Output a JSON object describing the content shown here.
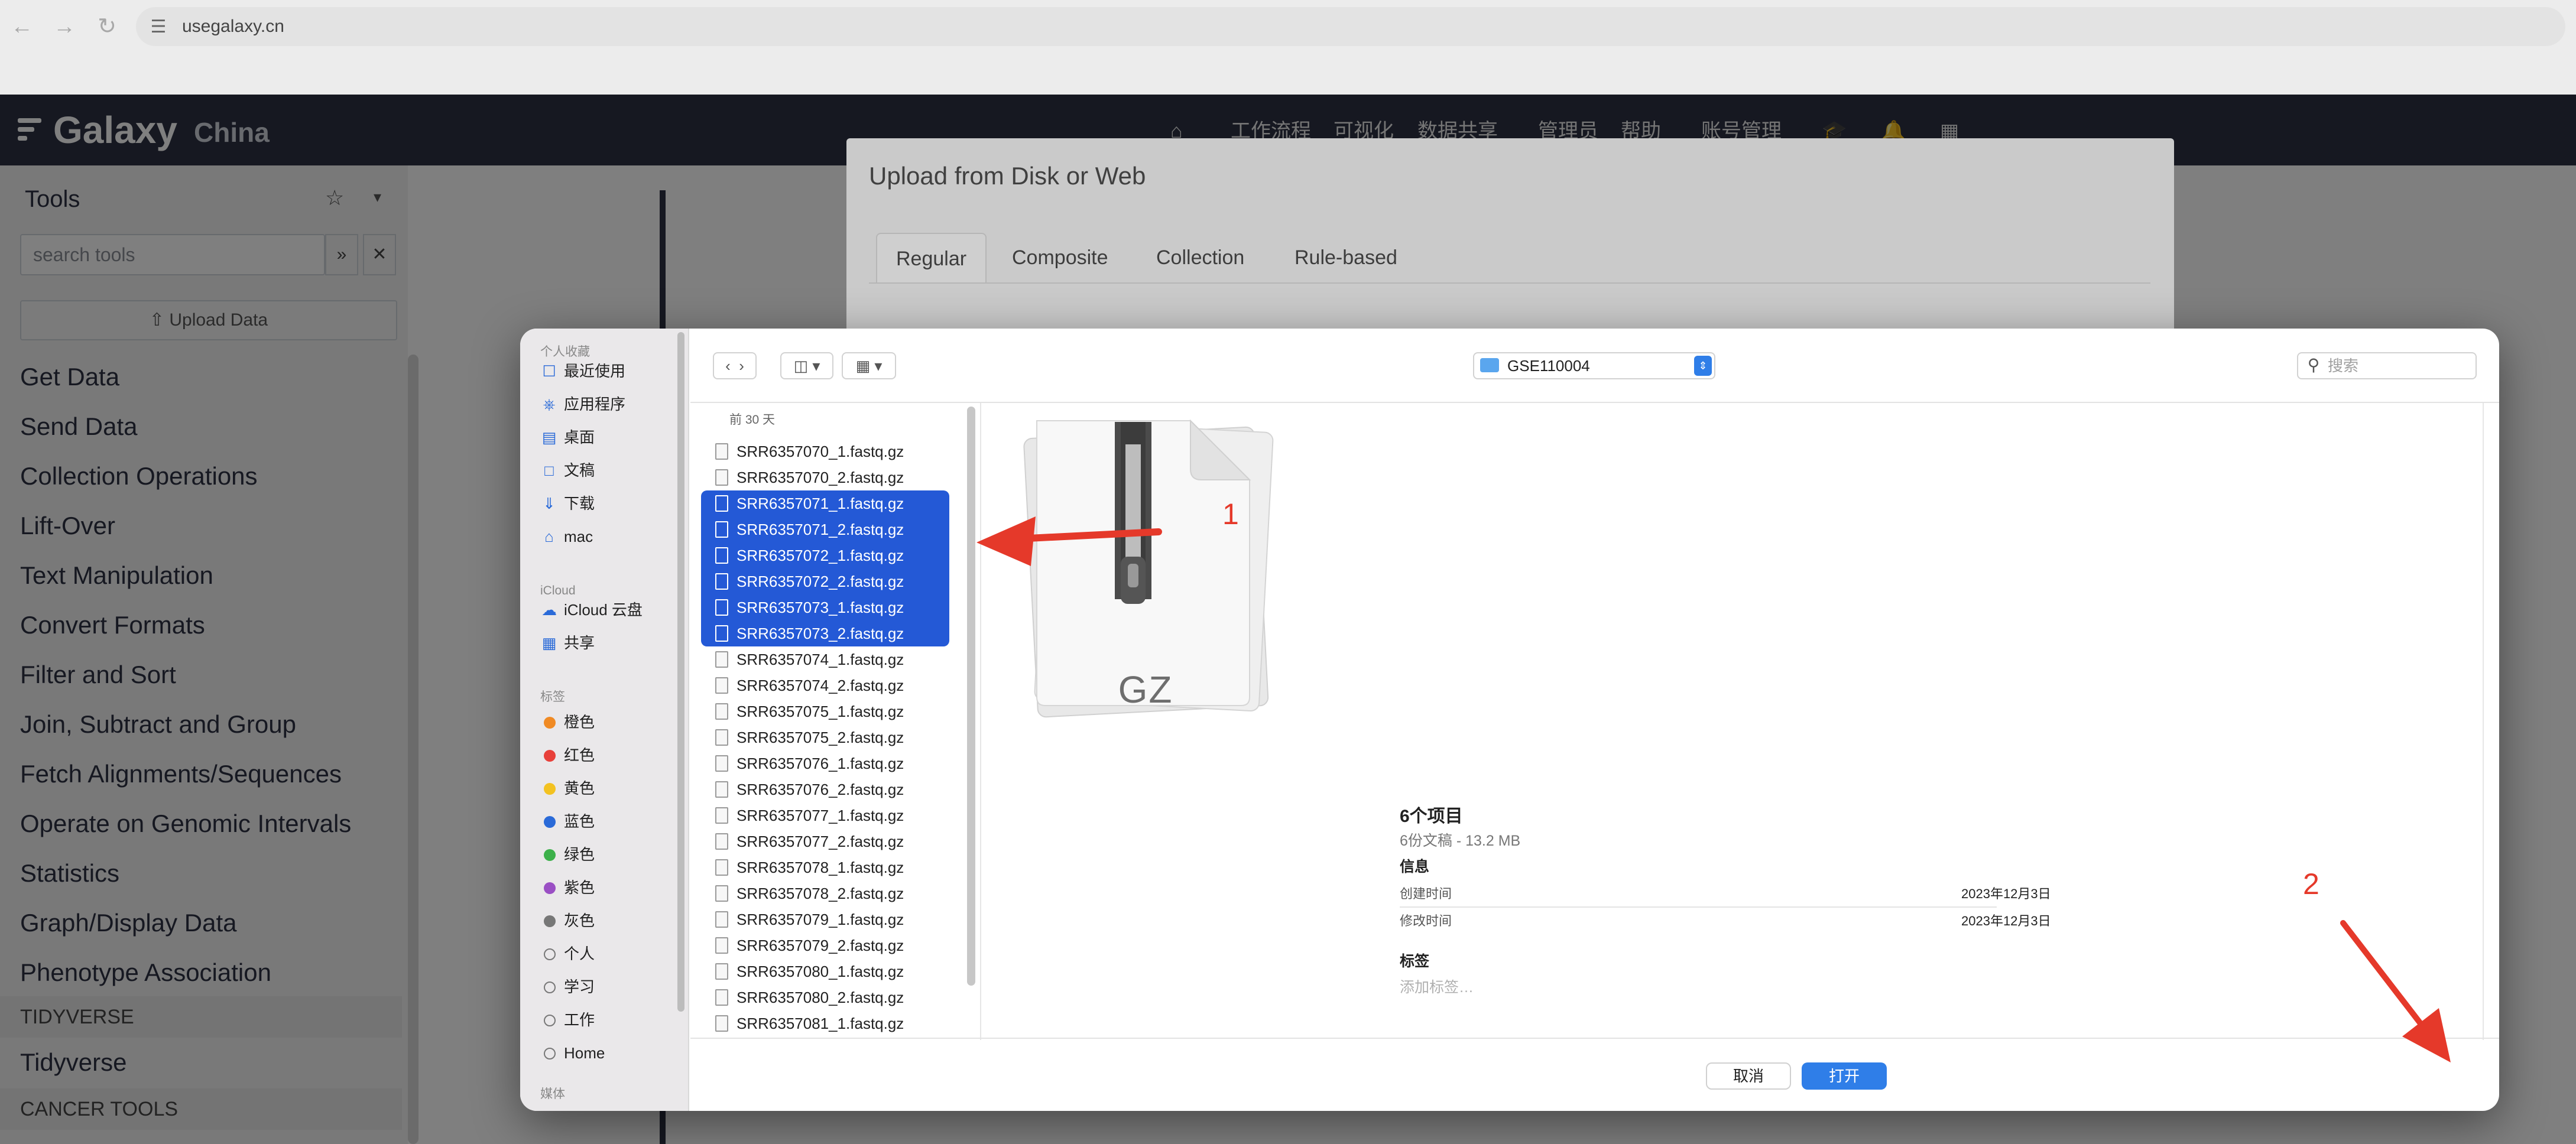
{
  "browser": {
    "url": "usegalaxy.cn",
    "back_icon": "arrow-left-icon",
    "forward_icon": "arrow-right-icon",
    "reload_icon": "reload-icon"
  },
  "galaxy": {
    "brand": "Galaxy",
    "brand_sub": "China",
    "nav": [
      "工作流程",
      "可视化",
      "数据共享",
      "管理员",
      "帮助",
      "账号管理"
    ],
    "tools_title": "Tools",
    "search_placeholder": "search tools",
    "upload_label": "Upload Data",
    "sections": [
      "Get Data",
      "Send Data",
      "Collection Operations",
      "Lift-Over",
      "Text Manipulation",
      "Convert Formats",
      "Filter and Sort",
      "Join, Subtract and Group",
      "Fetch Alignments/Sequences",
      "Operate on Genomic Intervals",
      "Statistics",
      "Graph/Display Data",
      "Phenotype Association"
    ],
    "label_tidyverse": "TIDYVERSE",
    "section_tidyverse": "Tidyverse",
    "label_cancer": "CANCER TOOLS"
  },
  "upload_modal": {
    "title": "Upload from Disk or Web",
    "tabs": [
      "Regular",
      "Composite",
      "Collection",
      "Rule-based"
    ]
  },
  "file_dialog": {
    "sidebar": {
      "favorites_label": "个人收藏",
      "favorites": [
        "最近使用",
        "应用程序",
        "桌面",
        "文稿",
        "下载",
        "mac"
      ],
      "icloud_label": "iCloud",
      "icloud": [
        "iCloud 云盘",
        "共享"
      ],
      "tags_label": "标签",
      "tags": [
        {
          "name": "橙色",
          "color": "#f08a24"
        },
        {
          "name": "红色",
          "color": "#e8403a"
        },
        {
          "name": "黄色",
          "color": "#f3c221"
        },
        {
          "name": "蓝色",
          "color": "#2a6ad8"
        },
        {
          "name": "绿色",
          "color": "#3cb04a"
        },
        {
          "name": "紫色",
          "color": "#9a4fc4"
        },
        {
          "name": "灰色",
          "color": "#777777"
        }
      ],
      "plain_tags": [
        "个人",
        "学习",
        "工作",
        "Home"
      ],
      "media_label": "媒体"
    },
    "folder": "GSE110004",
    "search_placeholder": "搜索",
    "list_header": "前 30 天",
    "files": [
      {
        "name": "SRR6357070_1.fastq.gz",
        "selected": false
      },
      {
        "name": "SRR6357070_2.fastq.gz",
        "selected": false
      },
      {
        "name": "SRR6357071_1.fastq.gz",
        "selected": true
      },
      {
        "name": "SRR6357071_2.fastq.gz",
        "selected": true
      },
      {
        "name": "SRR6357072_1.fastq.gz",
        "selected": true
      },
      {
        "name": "SRR6357072_2.fastq.gz",
        "selected": true
      },
      {
        "name": "SRR6357073_1.fastq.gz",
        "selected": true
      },
      {
        "name": "SRR6357073_2.fastq.gz",
        "selected": true
      },
      {
        "name": "SRR6357074_1.fastq.gz",
        "selected": false
      },
      {
        "name": "SRR6357074_2.fastq.gz",
        "selected": false
      },
      {
        "name": "SRR6357075_1.fastq.gz",
        "selected": false
      },
      {
        "name": "SRR6357075_2.fastq.gz",
        "selected": false
      },
      {
        "name": "SRR6357076_1.fastq.gz",
        "selected": false
      },
      {
        "name": "SRR6357076_2.fastq.gz",
        "selected": false
      },
      {
        "name": "SRR6357077_1.fastq.gz",
        "selected": false
      },
      {
        "name": "SRR6357077_2.fastq.gz",
        "selected": false
      },
      {
        "name": "SRR6357078_1.fastq.gz",
        "selected": false
      },
      {
        "name": "SRR6357078_2.fastq.gz",
        "selected": false
      },
      {
        "name": "SRR6357079_1.fastq.gz",
        "selected": false
      },
      {
        "name": "SRR6357079_2.fastq.gz",
        "selected": false
      },
      {
        "name": "SRR6357080_1.fastq.gz",
        "selected": false
      },
      {
        "name": "SRR6357080_2.fastq.gz",
        "selected": false
      },
      {
        "name": "SRR6357081_1.fastq.gz",
        "selected": false
      }
    ],
    "preview": {
      "icon_label": "GZ",
      "count_title": "6个项目",
      "count_sub": "6份文稿 - 13.2 MB",
      "info_label": "信息",
      "created_key": "创建时间",
      "created_val": "2023年12月3日",
      "modified_key": "修改时间",
      "modified_val": "2023年12月3日",
      "tags_label": "标签",
      "tags_placeholder": "添加标签…"
    },
    "cancel_label": "取消",
    "open_label": "打开"
  },
  "annotations": {
    "step1": "1",
    "step2": "2",
    "color": "#e5392a"
  }
}
